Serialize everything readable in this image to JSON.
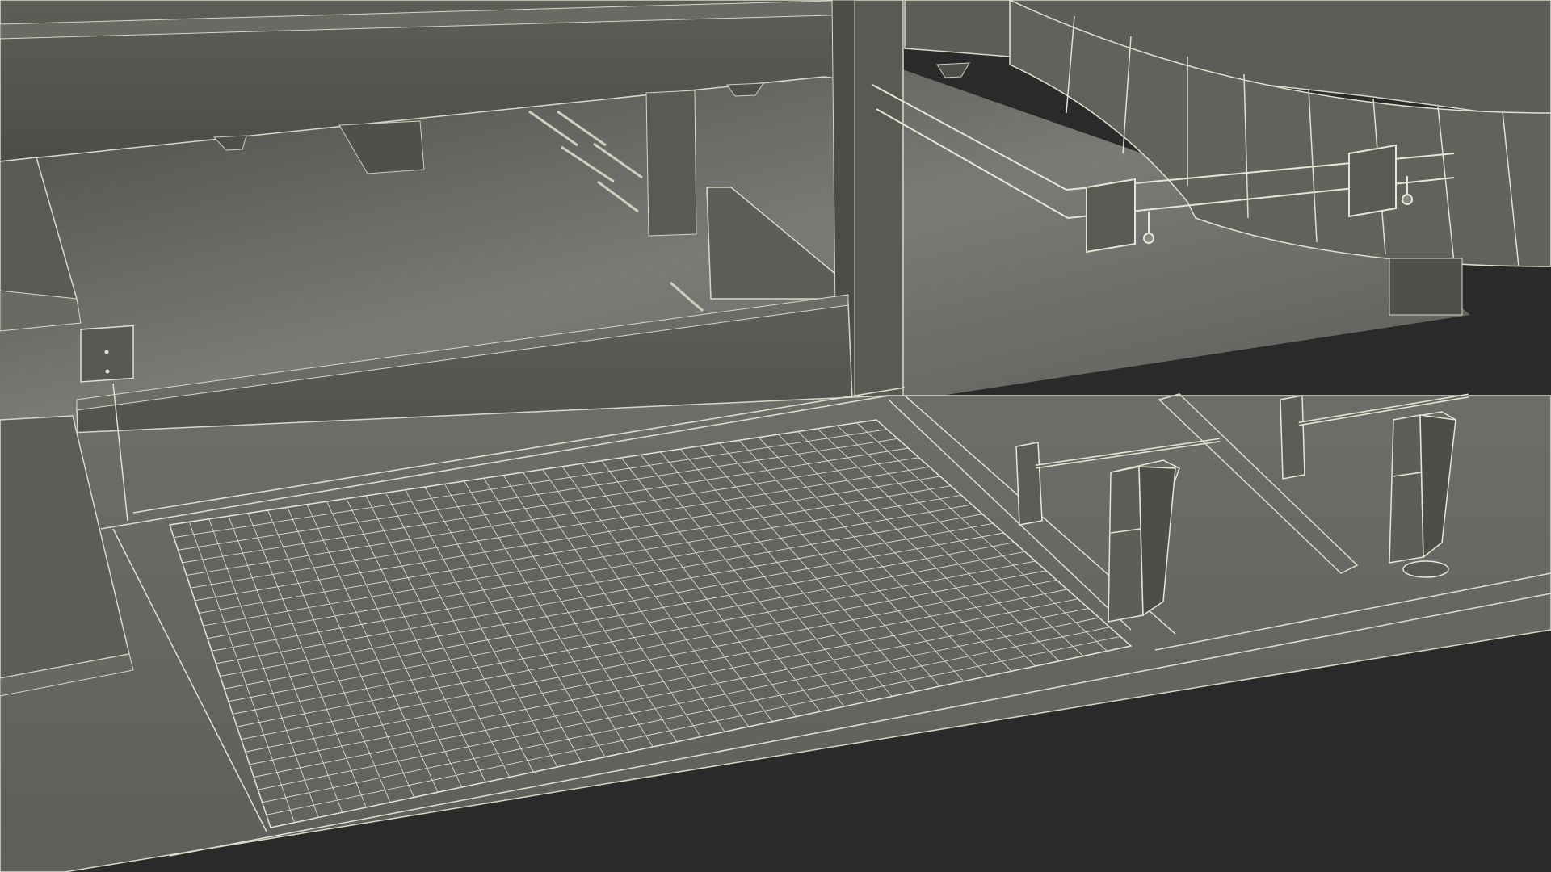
{
  "scene": {
    "subject": "parking-garage-entrance-wireframe-render",
    "background_color": "#2a2a2a",
    "surface_colors": {
      "floor_light": "#6e6e6a",
      "floor_dark": "#4a4a47",
      "wall": "#5a5a56",
      "ceiling": "#55554f",
      "edge_line": "#e6e6d8"
    },
    "grid": {
      "rows": 24,
      "cols": 36
    }
  }
}
